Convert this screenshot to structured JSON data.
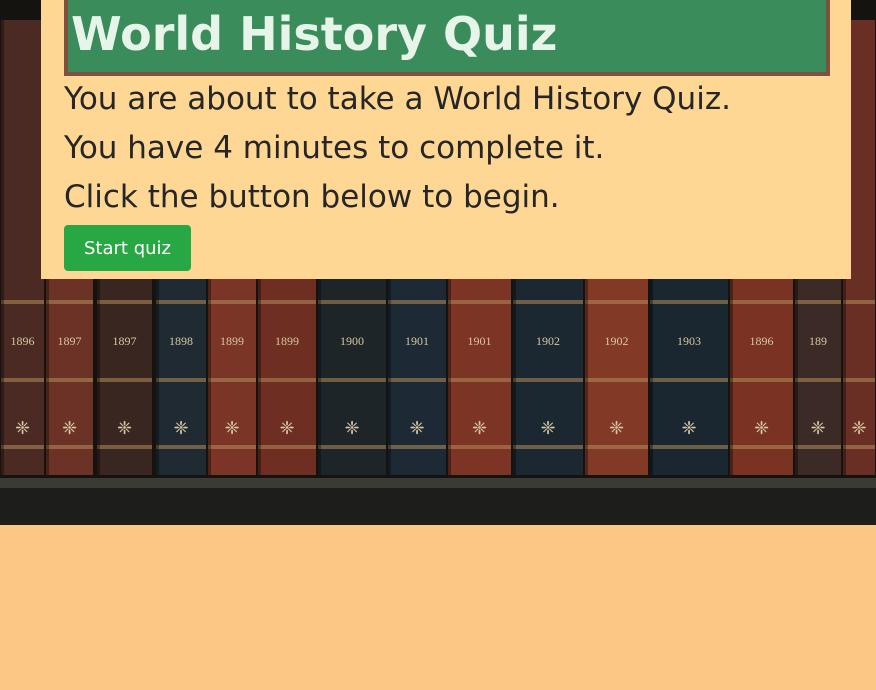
{
  "quiz": {
    "title": "World History Quiz",
    "line1": "You are about to take a World History Quiz.",
    "line2": "You have 4 minutes to complete it.",
    "line3": "Click the button below to begin.",
    "start_label": "Start quiz"
  },
  "background": {
    "spine_years": [
      "1896",
      "1897",
      "1897",
      "1898",
      "1899",
      "1899",
      "1900",
      "1901",
      "1901",
      "1902",
      "1902",
      "1903",
      "1896",
      "189"
    ]
  },
  "colors": {
    "page_bg": "#fcc684",
    "card_bg": "#fed795",
    "title_bg": "#3a8c5a",
    "title_border": "#7d5040",
    "button": "#28a745"
  }
}
